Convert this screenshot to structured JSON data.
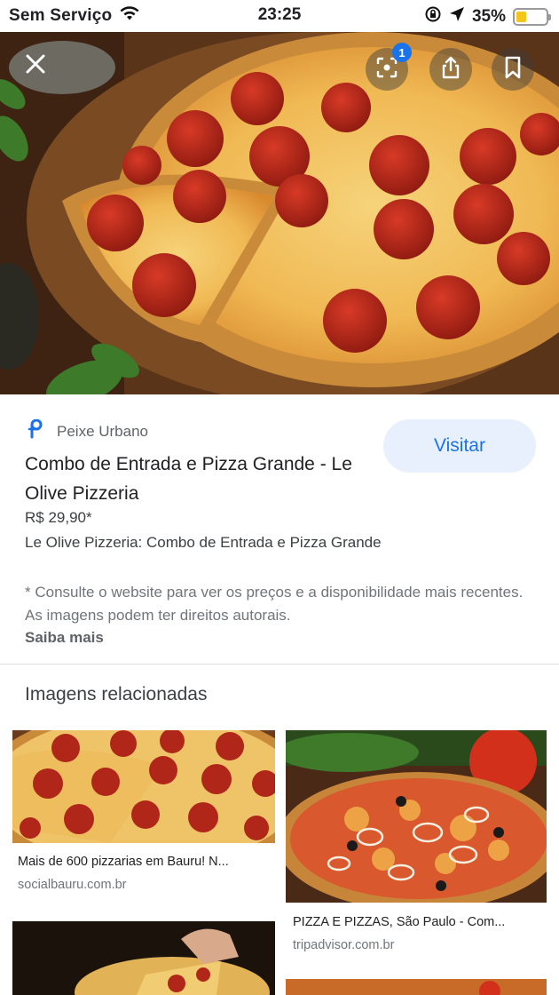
{
  "status_bar": {
    "carrier": "Sem Serviço",
    "time": "23:25",
    "battery_pct": "35%",
    "battery_level": 0.35,
    "icons": [
      "wifi-icon",
      "screen-rotation-lock-icon",
      "location-arrow-icon",
      "battery-icon"
    ]
  },
  "hero": {
    "lens_badge": "1",
    "icons": [
      "close-icon",
      "lens-icon",
      "share-icon",
      "bookmark-icon"
    ]
  },
  "result": {
    "source_name": "Peixe Urbano",
    "visit_label": "Visitar",
    "title": "Combo de Entrada e Pizza Grande - Le Olive Pizzeria",
    "price": "R$ 29,90*",
    "description": "Le Olive Pizzeria: Combo de Entrada e Pizza Grande",
    "disclaimer": "* Consulte o website para ver os preços e a disponibilidade mais recentes. As imagens podem ter direitos autorais.",
    "learn_more": "Saiba mais"
  },
  "related": {
    "heading": "Imagens relacionadas",
    "items": [
      {
        "title": "Mais de 600 pizzarias em Bauru! N...",
        "source": "socialbauru.com.br"
      },
      {
        "title": "PIZZA E PIZZAS, São Paulo - Com...",
        "source": "tripadvisor.com.br"
      }
    ]
  },
  "colors": {
    "accent": "#1a73e8",
    "visit_bg": "#e8f0fe",
    "battery": "#f5c518"
  }
}
